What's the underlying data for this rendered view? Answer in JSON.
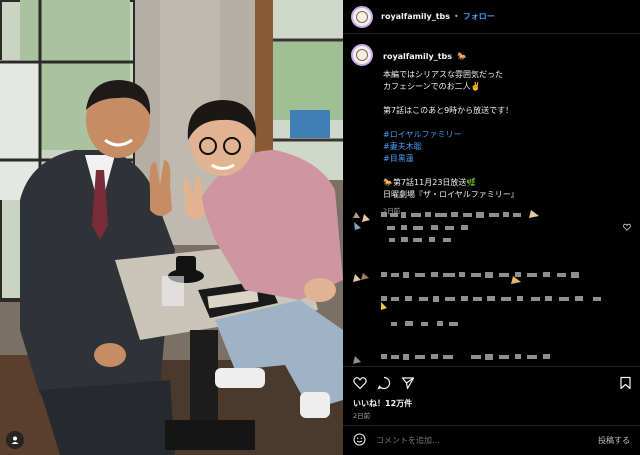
{
  "header": {
    "username": "royalfamily_tbs",
    "separator": "•",
    "follow_label": "フォロー"
  },
  "caption": {
    "username": "royalfamily_tbs",
    "lines": [
      "本編ではシリアスな雰囲気だった",
      "カフェシーンでのお二人✌️"
    ],
    "line2": "第7話はこのあと9時から放送です！",
    "hashtags": [
      "#ロイヤルファミリー",
      "#妻夫木聡",
      "#目黒蓮"
    ],
    "episode_line": "🐎第7話11月23日放送🌿",
    "program_line": "日曜劇場『ザ・ロイヤルファミリー』",
    "time": "2日前"
  },
  "icons": {
    "verified": "horse-emoji-icon",
    "heart": "heart-icon",
    "comment": "comment-bubble-icon",
    "share": "paper-plane-icon",
    "save": "bookmark-icon",
    "emoji": "emoji-smile-icon",
    "tag": "user-tag-icon"
  },
  "post": {
    "likes": "いいね！12万件",
    "time": "2日前"
  },
  "comment_bar": {
    "placeholder": "コメントを追加...",
    "post_label": "投稿する"
  },
  "colors": {
    "background": "#000000",
    "link": "#4a9df8",
    "muted": "#a8a8a8"
  }
}
